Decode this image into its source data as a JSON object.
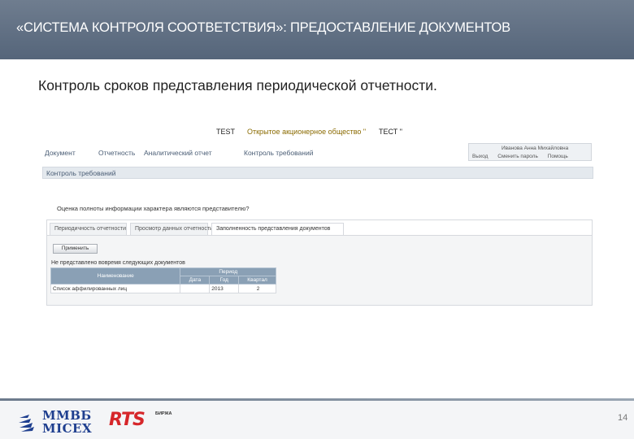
{
  "header": {
    "title": "«СИСТЕМА КОНТРОЛЯ СООТВЕТСТВИЯ»: ПРЕДОСТАВЛЕНИЕ ДОКУМЕНТОВ"
  },
  "subtitle": "Контроль сроков представления периодической отчетности.",
  "app": {
    "test_label": "TEST",
    "company_name": "Открытое акционерное общество \"",
    "company_test": "ТЕСТ \"",
    "nav": [
      "Документ",
      "Отчетность",
      "Аналитический отчет",
      "Контроль требований"
    ],
    "user": {
      "name": "Иванова Анна Михайловна",
      "links": [
        "Выход",
        "Сменить пароль",
        "Помощь"
      ]
    },
    "section_title": "Контроль требований",
    "question": "Оценка полноты информации характера являются представителю?",
    "tabs": [
      "Периодичность отчетности",
      "Просмотр данных отчетности",
      "Заполненность представления документов"
    ],
    "active_tab": 2,
    "button_label": "Применить",
    "table_caption": "Не представлено вовремя следующих документов",
    "table": {
      "col_name": "Наименование",
      "group_header": "Период",
      "col_date": "Дата",
      "col_year": "Год",
      "col_quarter": "Квартал",
      "rows": [
        {
          "name": "Список аффилированных лиц",
          "date": "",
          "year": "2013",
          "quarter": "2"
        }
      ]
    }
  },
  "footer": {
    "logo_top": "ММВБ",
    "logo_bottom": "MICEX",
    "rts": "RTS",
    "rts_sub": "БИРЖА",
    "page_number": "14"
  }
}
